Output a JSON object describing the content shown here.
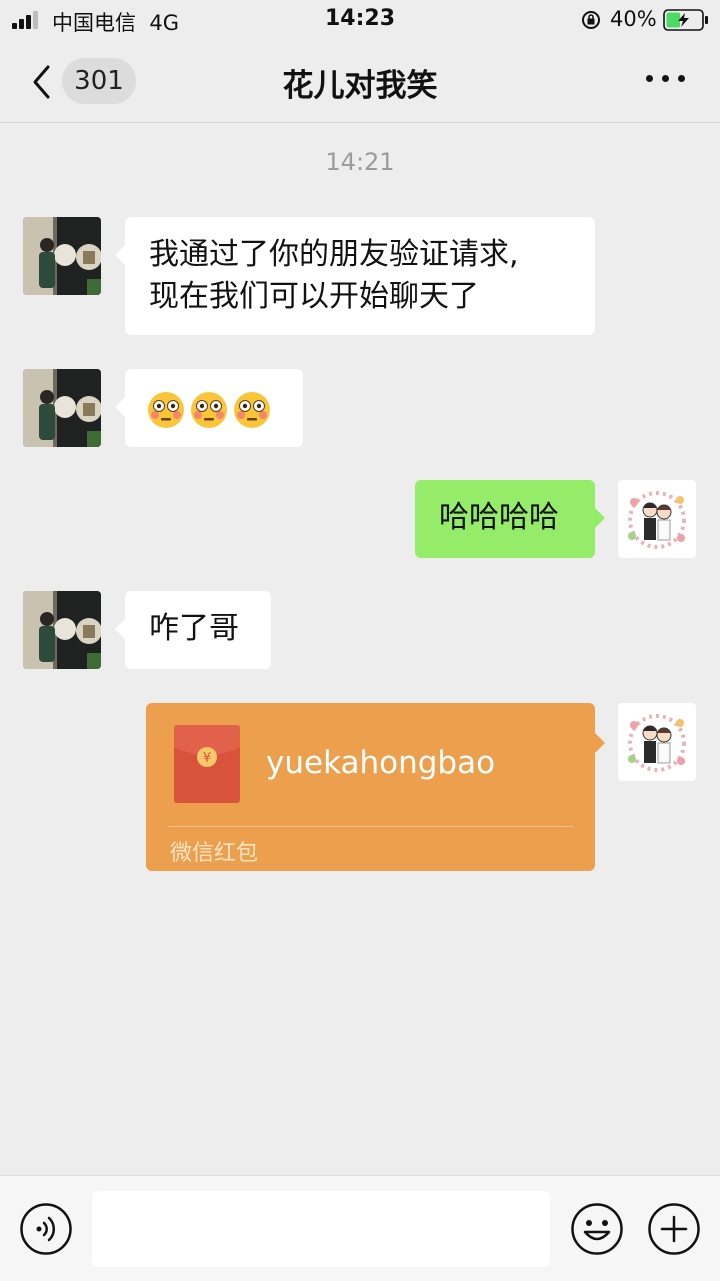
{
  "status_bar": {
    "carrier": "中国电信",
    "network": "4G",
    "time": "14:23",
    "battery_percent": "40%",
    "battery_level": 0.4,
    "charging": true,
    "signal_bars": 3
  },
  "nav": {
    "back_icon": "chevron-left-icon",
    "unread_count": "301",
    "title": "花儿对我笑",
    "more_icon": "ellipsis-icon"
  },
  "chat": {
    "timestamp": "14:21",
    "messages": [
      {
        "side": "left",
        "text_line1": "我通过了你的朋友验证请求,",
        "text_line2": "现在我们可以开始聊天了"
      },
      {
        "side": "left",
        "emoji": "flushed-face",
        "emoji_count": 3
      },
      {
        "side": "right",
        "text": "哈哈哈哈"
      },
      {
        "side": "left",
        "text": "咋了哥"
      },
      {
        "side": "right",
        "type": "red-packet",
        "name": "yuekahongbao",
        "label": "微信红包"
      }
    ]
  },
  "input_bar": {
    "voice_icon": "voice-icon",
    "emoji_icon": "smiley-icon",
    "plus_icon": "plus-icon",
    "placeholder": ""
  },
  "colors": {
    "background": "#ededed",
    "bubble_self": "#95ec69",
    "bubble_other": "#ffffff",
    "red_packet": "#ec9f4d",
    "timestamp_text": "#9b9b9b"
  }
}
